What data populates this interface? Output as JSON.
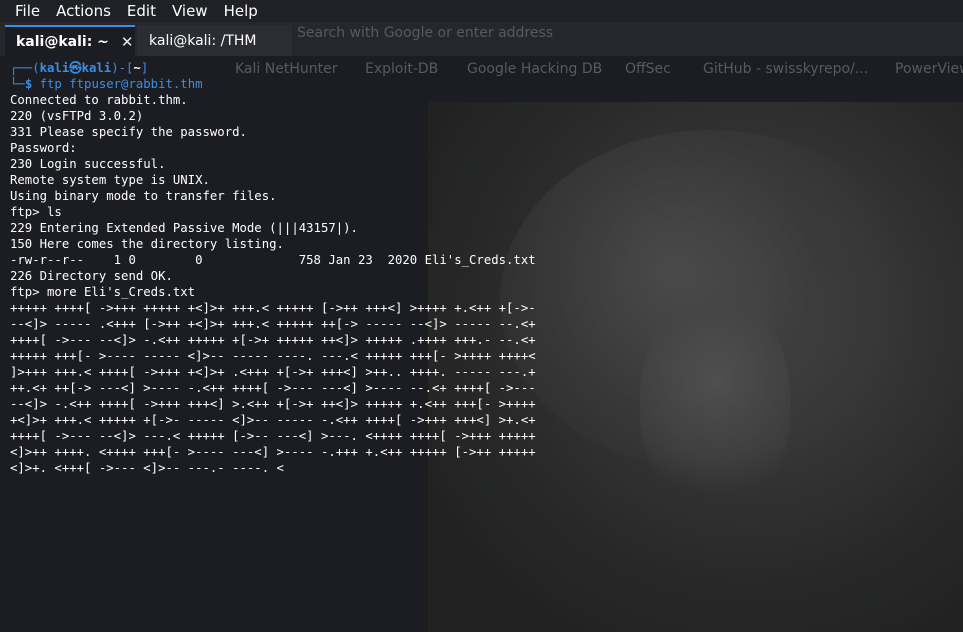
{
  "menu": [
    "File",
    "Actions",
    "Edit",
    "View",
    "Help"
  ],
  "tabs": [
    {
      "label": "kali@kali: ~",
      "close": "✕"
    },
    {
      "label": "kali@kali: /THM",
      "close": ""
    }
  ],
  "browser_ghost": {
    "address": "Search with Google or enter address",
    "bookmarks": [
      "Kali NetHunter",
      "Exploit-DB",
      "Google Hacking DB",
      "OffSec",
      "GitHub - swisskyrepo/...",
      "PowerView"
    ]
  },
  "prompt": {
    "corner_top": "┌──(",
    "user": "kali",
    "at": "㉿",
    "host": "kali",
    "close_paren": ")-[",
    "dir": "~",
    "close_bracket": "]",
    "corner_bottom": "└─",
    "dollar": "$",
    "command": "ftp ftpuser@rabbit.thm"
  },
  "output": [
    "Connected to rabbit.thm.",
    "220 (vsFTPd 3.0.2)",
    "331 Please specify the password.",
    "Password:",
    "230 Login successful.",
    "Remote system type is UNIX.",
    "Using binary mode to transfer files.",
    "ftp> ls",
    "229 Entering Extended Passive Mode (|||43157|).",
    "150 Here comes the directory listing.",
    "-rw-r--r--    1 0        0             758 Jan 23  2020 Eli's_Creds.txt",
    "226 Directory send OK.",
    "ftp> more Eli's_Creds.txt",
    "+++++ ++++[ ->+++ +++++ +<]>+ +++.< +++++ [->++ +++<] >++++ +.<++ +[->-",
    "--<]> ----- .<+++ [->++ +<]>+ +++.< +++++ ++[-> ----- --<]> ----- --.<+",
    "++++[ ->--- --<]> -.<++ +++++ +[->+ +++++ ++<]> +++++ .++++ +++.- --.<+",
    "+++++ +++[- >---- ----- <]>-- ----- ----. ---.< +++++ +++[- >++++ ++++<",
    "]>+++ +++.< ++++[ ->+++ +<]>+ .<+++ +[->+ +++<] >++.. ++++. ----- ---.+",
    "++.<+ ++[-> ---<] >---- -.<++ ++++[ ->--- ---<] >---- --.<+ ++++[ ->---",
    "--<]> -.<++ ++++[ ->+++ +++<] >.<++ +[->+ ++<]> +++++ +.<++ +++[- >++++",
    "+<]>+ +++.< +++++ +[->- ----- <]>-- ----- -.<++ ++++[ ->+++ +++<] >+.<+",
    "++++[ ->--- --<]> ---.< +++++ [->-- ---<] >---. <++++ ++++[ ->+++ +++++",
    "<]>++ ++++. <++++ +++[- >---- ---<] >---- -.+++ +.<++ +++++ [->++ +++++",
    "<]>+. <+++[ ->--- <]>-- ---.- ----. <"
  ]
}
